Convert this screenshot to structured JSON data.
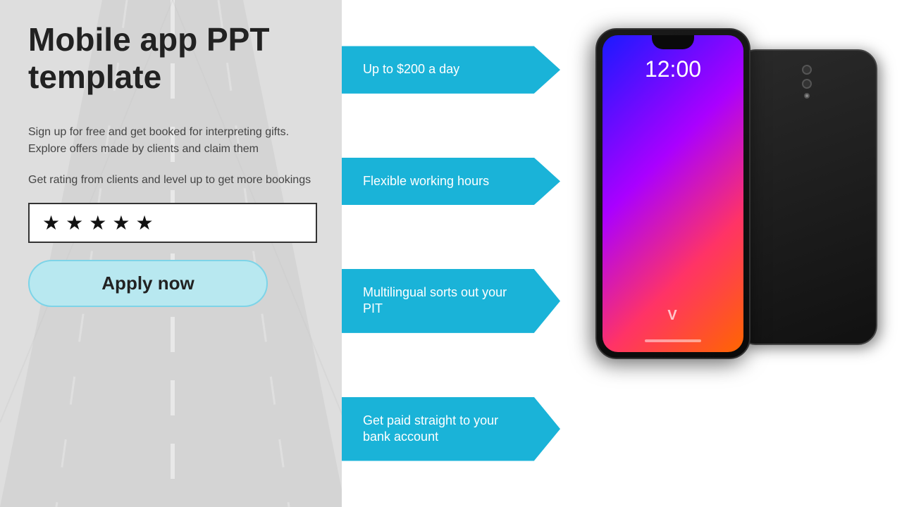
{
  "left": {
    "title": "Mobile app PPT template",
    "desc1": "Sign up for free and get booked for interpreting gifts. Explore offers made by clients and claim them",
    "desc2": "Get rating from clients and level up to get more bookings",
    "stars": [
      "★",
      "★",
      "★",
      "★",
      "★"
    ],
    "apply_button": "Apply now"
  },
  "badges": [
    {
      "id": "badge-1",
      "text": "Up to $200 a day"
    },
    {
      "id": "badge-2",
      "text": "Flexible working hours"
    },
    {
      "id": "badge-3",
      "text": "Multilingual sorts out your PIT"
    },
    {
      "id": "badge-4",
      "text": "Get paid straight to your bank account"
    }
  ],
  "phone": {
    "time": "12:00",
    "brand": "V"
  },
  "colors": {
    "badge_bg": "#1ab3d8",
    "apply_bg": "#b8e8f0",
    "apply_border": "#7dd4e8"
  }
}
